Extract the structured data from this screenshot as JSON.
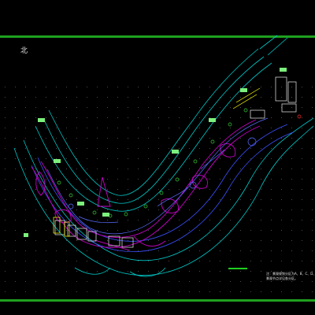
{
  "drawing": {
    "north_label": "北",
    "note_lines": [
      "注：景观规划分区为A、B、C、D、",
      "景观节点详见各分区。"
    ]
  },
  "colors": {
    "background": "#000000",
    "border": "#1fa01f",
    "road": "#00c8c8",
    "path": "#3c50ff",
    "planting": "#c800c8",
    "label_box": "#7cf07c",
    "building": "#d0d0d0",
    "accent": "#ffff00"
  }
}
